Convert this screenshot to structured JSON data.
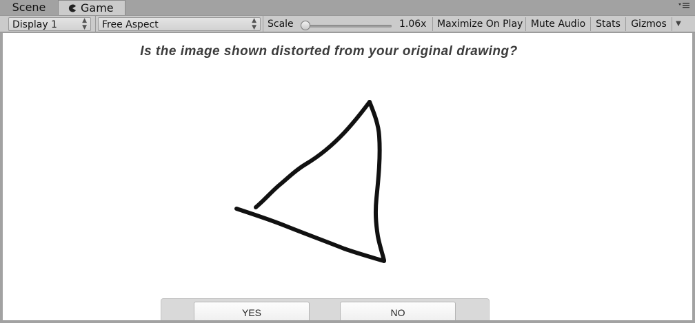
{
  "tabs": {
    "scene_label": "Scene",
    "game_label": "Game"
  },
  "toolbar": {
    "display_label": "Display 1",
    "aspect_label": "Free Aspect",
    "scale_label": "Scale",
    "scale_value": "1.06x",
    "scale_slider_fraction": 0.02,
    "maximize_label": "Maximize On Play",
    "mute_label": "Mute Audio",
    "stats_label": "Stats",
    "gizmos_label": "Gizmos"
  },
  "game": {
    "question": "Is the image shown distorted from your original drawing?",
    "yes_label": "YES",
    "no_label": "NO",
    "stroke_color": "#111111"
  },
  "icons": {
    "game_tab": "pacman-icon",
    "panel_menu": "panel-menu-icon",
    "dropdown": "up-down-arrows-icon"
  }
}
